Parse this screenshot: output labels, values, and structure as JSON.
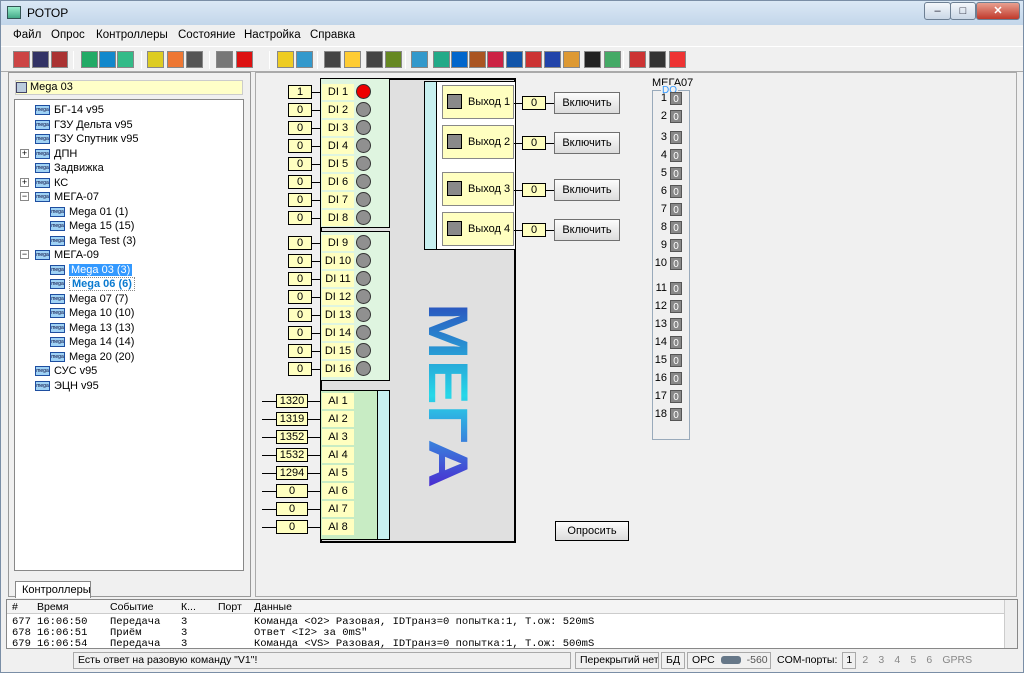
{
  "window": {
    "title": "РОТОР",
    "min": "–",
    "max": "□",
    "close": "✕"
  },
  "menu": [
    "Файл",
    "Опрос",
    "Контроллеры",
    "Состояние",
    "Настройка",
    "Справка"
  ],
  "tree": {
    "root": "Mega 03",
    "tab": "Контроллеры",
    "items": [
      {
        "label": "БГ-14 v95"
      },
      {
        "label": "ГЗУ Дельта v95"
      },
      {
        "label": "ГЗУ Спутник v95"
      },
      {
        "label": "ДПН"
      },
      {
        "label": "Задвижка"
      },
      {
        "label": "КС"
      },
      {
        "label": "МЕГА-07"
      },
      {
        "label": "Mega 01 (1)"
      },
      {
        "label": "Mega 15 (15)"
      },
      {
        "label": "Mega Test (3)"
      },
      {
        "label": "МЕГА-09"
      },
      {
        "label": "Mega 03 (3)"
      },
      {
        "label": "Mega 06 (6)"
      },
      {
        "label": "Mega 07 (7)"
      },
      {
        "label": "Mega 10 (10)"
      },
      {
        "label": "Mega 13 (13)"
      },
      {
        "label": "Mega 14 (14)"
      },
      {
        "label": "Mega 20 (20)"
      },
      {
        "label": "СУС v95"
      },
      {
        "label": "ЭЦН v95"
      }
    ]
  },
  "di": {
    "values": [
      "1",
      "0",
      "0",
      "0",
      "0",
      "0",
      "0",
      "0",
      "0",
      "0",
      "0",
      "0",
      "0",
      "0",
      "0",
      "0"
    ],
    "labels": [
      "DI 1",
      "DI 2",
      "DI 3",
      "DI 4",
      "DI 5",
      "DI 6",
      "DI 7",
      "DI 8",
      "DI 9",
      "DI 10",
      "DI 11",
      "DI 12",
      "DI 13",
      "DI 14",
      "DI 15",
      "DI 16"
    ],
    "states": [
      true,
      false,
      false,
      false,
      false,
      false,
      false,
      false,
      false,
      false,
      false,
      false,
      false,
      false,
      false,
      false
    ]
  },
  "ai": {
    "values": [
      "1320",
      "1319",
      "1352",
      "1532",
      "1294",
      "0",
      "0",
      "0"
    ],
    "labels": [
      "AI 1",
      "AI 2",
      "AI 3",
      "AI 4",
      "AI 5",
      "AI 6",
      "AI 7",
      "AI 8"
    ]
  },
  "outputs": [
    {
      "label": "Выход 1",
      "value": "0",
      "button": "Включить"
    },
    {
      "label": "Выход 2",
      "value": "0",
      "button": "Включить"
    },
    {
      "label": "Выход 3",
      "value": "0",
      "button": "Включить"
    },
    {
      "label": "Выход 4",
      "value": "0",
      "button": "Включить"
    }
  ],
  "brand": "МЕГА",
  "do_panel": {
    "title": "МЕГА07",
    "group": "DO",
    "numbers": [
      "1",
      "2",
      "3",
      "4",
      "5",
      "6",
      "7",
      "8",
      "9",
      "10",
      "11",
      "12",
      "13",
      "14",
      "15",
      "16",
      "17",
      "18"
    ],
    "values": [
      "0",
      "0",
      "0",
      "0",
      "0",
      "0",
      "0",
      "0",
      "0",
      "0",
      "0",
      "0",
      "0",
      "0",
      "0",
      "0",
      "0",
      "0"
    ]
  },
  "poll_button": "Опросить",
  "log": {
    "headers": [
      "#",
      "Время",
      "Событие",
      "К...",
      "Порт",
      "Данные"
    ],
    "rows": [
      {
        "n": "677",
        "time": "16:06:50",
        "event": "Передача",
        "k": "3",
        "port": "",
        "data": "Команда <O2> Разовая, IDTранз=0 попытка:1, Т.ож: 520mS"
      },
      {
        "n": "678",
        "time": "16:06:51",
        "event": "Приём",
        "k": "3",
        "port": "",
        "data": "Ответ <I2> за 0mS\""
      },
      {
        "n": "679",
        "time": "16:06:54",
        "event": "Передача",
        "k": "3",
        "port": "",
        "data": "Команда <VS> Разовая, IDTранз=0 попытка:1, Т.ож: 500mS"
      }
    ]
  },
  "status": {
    "message": "Есть ответ на разовую команду \"V1\"!",
    "overlap": "Перекрытий нет",
    "db": "БД",
    "opc": "OPC",
    "opc_val": "-560",
    "com_label": "COM-порты:",
    "ports": [
      "1",
      "2",
      "3",
      "4",
      "5",
      "6"
    ],
    "gprs": "GPRS"
  }
}
